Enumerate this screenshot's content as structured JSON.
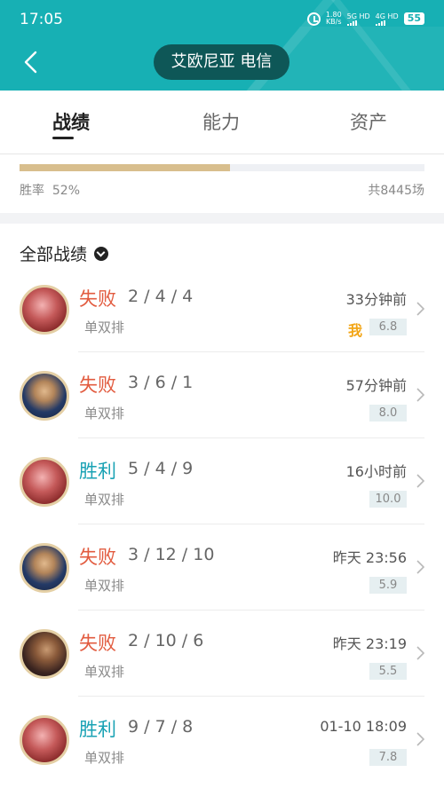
{
  "status_bar": {
    "time": "17:05",
    "speed": "1.80\nKB/s",
    "net1": "5G HD",
    "net2": "4G HD",
    "battery": "55"
  },
  "header": {
    "title": "艾欧尼亚 电信",
    "back_icon": "chevron-left-icon",
    "accent_color": "#17b0b4"
  },
  "tabs": [
    {
      "label": "战绩",
      "active": true
    },
    {
      "label": "能力",
      "active": false
    },
    {
      "label": "资产",
      "active": false
    }
  ],
  "win_rate": {
    "label": "胜率  52%",
    "total": "共8445场",
    "fraction": 0.52
  },
  "section": {
    "title": "全部战绩",
    "dropdown_icon": "chevron-down-circle-icon"
  },
  "matches": [
    {
      "result": "失败",
      "kda": "2 / 4 / 4",
      "mode": "单双排",
      "time": "33分钟前",
      "score": "6.8",
      "badge": "我",
      "avatar": "av-red"
    },
    {
      "result": "失败",
      "kda": "3 / 6 / 1",
      "mode": "单双排",
      "time": "57分钟前",
      "score": "8.0",
      "badge": "",
      "avatar": "av-blue"
    },
    {
      "result": "胜利",
      "kda": "5 / 4 / 9",
      "mode": "单双排",
      "time": "16小时前",
      "score": "10.0",
      "badge": "",
      "avatar": "av-red"
    },
    {
      "result": "失败",
      "kda": "3 / 12 / 10",
      "mode": "单双排",
      "time": "昨天 23:56",
      "score": "5.9",
      "badge": "",
      "avatar": "av-blue"
    },
    {
      "result": "失败",
      "kda": "2 / 10 / 6",
      "mode": "单双排",
      "time": "昨天 23:19",
      "score": "5.5",
      "badge": "",
      "avatar": "av-dark"
    },
    {
      "result": "胜利",
      "kda": "9 / 7 / 8",
      "mode": "单双排",
      "time": "01-10 18:09",
      "score": "7.8",
      "badge": "",
      "avatar": "av-red"
    }
  ],
  "colors": {
    "lose": "#e25b3f",
    "win": "#19a2b4",
    "win_rate_fill": "#d8be8d"
  }
}
